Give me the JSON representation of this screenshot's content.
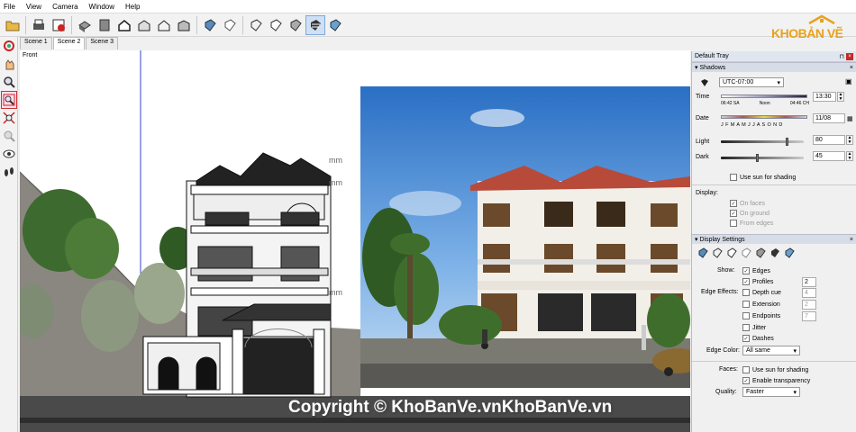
{
  "menu": [
    "File",
    "View",
    "Camera",
    "Window",
    "Help"
  ],
  "toolbar_icons": [
    "open-icon",
    "print-icon",
    "model-info-icon",
    "components-icon",
    "box-icon",
    "home-icon",
    "house-front-icon",
    "house-outline-icon",
    "house-garage-icon",
    "xray-icon",
    "back-edges-icon",
    "wireframe-icon",
    "hidden-line-icon",
    "shaded-icon",
    "shaded-textures-icon",
    "monochrome-icon"
  ],
  "scenes": [
    "Scene 1",
    "Scene 2",
    "Scene 3"
  ],
  "selected_scene": "Scene 2",
  "left_tools": [
    "orbit-icon",
    "pan-icon",
    "zoom-icon",
    "zoom-window-icon",
    "zoom-extents-icon",
    "previous-icon",
    "look-around-icon",
    "walk-icon"
  ],
  "viewport": {
    "view_label": "Front",
    "copyright": "Copyright © KhoBanVe.vnKhoBanVe.vn"
  },
  "logo": {
    "kho": "KHO",
    "banve": "BẢN VẼ"
  },
  "tray": {
    "title": "Default Tray",
    "shadows": {
      "title": "Shadows",
      "timezone": "UTC-07:00",
      "time_label": "Time",
      "time_marks": [
        "06:42 SA",
        "Noon",
        "04:46 CH"
      ],
      "time_value": "13:30",
      "date_label": "Date",
      "months": "J F M A M J J A S O N D",
      "date_value": "11/08",
      "light_label": "Light",
      "light_value": "80",
      "light_level": 0.8,
      "dark_label": "Dark",
      "dark_value": "45",
      "dark_level": 0.45,
      "use_sun_shading": "Use sun for shading",
      "display_label": "Display:",
      "on_faces": "On faces",
      "on_ground": "On ground",
      "from_edges": "From edges"
    },
    "display": {
      "title": "Display Settings",
      "show_label": "Show:",
      "edges": "Edges",
      "profiles": "Profiles",
      "profiles_value": "2",
      "edge_effects_label": "Edge Effects:",
      "depth_cue": "Depth cue",
      "depth_cue_value": "4",
      "extension": "Extension",
      "extension_value": "2",
      "endpoints": "Endpoints",
      "endpoints_value": "7",
      "jitter": "Jitter",
      "dashes": "Dashes",
      "edge_color_label": "Edge Color:",
      "edge_color_value": "All same",
      "faces_label": "Faces:",
      "faces_sun": "Use sun for shading",
      "enable_transparency": "Enable transparency",
      "quality_label": "Quality:",
      "quality_value": "Faster"
    }
  }
}
